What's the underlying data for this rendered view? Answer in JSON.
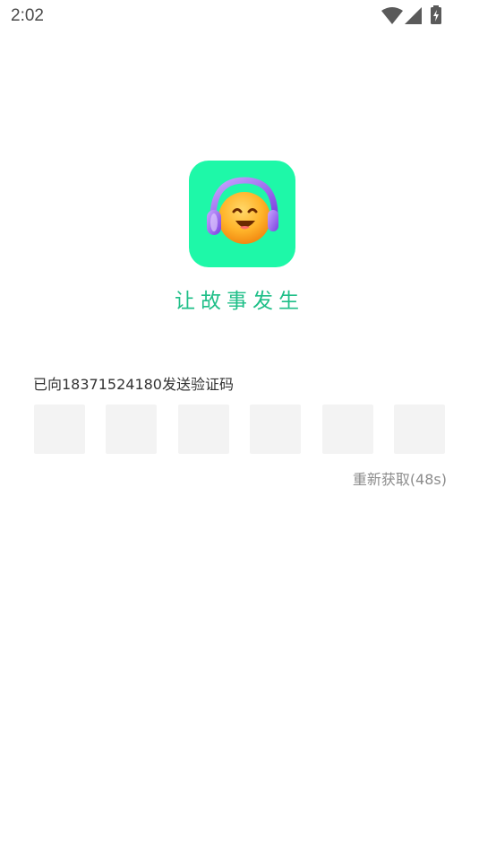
{
  "status_bar": {
    "time": "2:02"
  },
  "logo": {
    "background": "#1ef8a8",
    "icon": "emoji-headphones-icon"
  },
  "slogan": "让故事发生",
  "verification": {
    "sent_text": "已向18371524180发送验证码",
    "code_digits": [
      "",
      "",
      "",
      "",
      "",
      ""
    ],
    "resend_text": "重新获取(48s)"
  },
  "colors": {
    "accent": "#1fbf88",
    "box_bg": "#f3f3f3",
    "muted": "#8c8c8c"
  }
}
